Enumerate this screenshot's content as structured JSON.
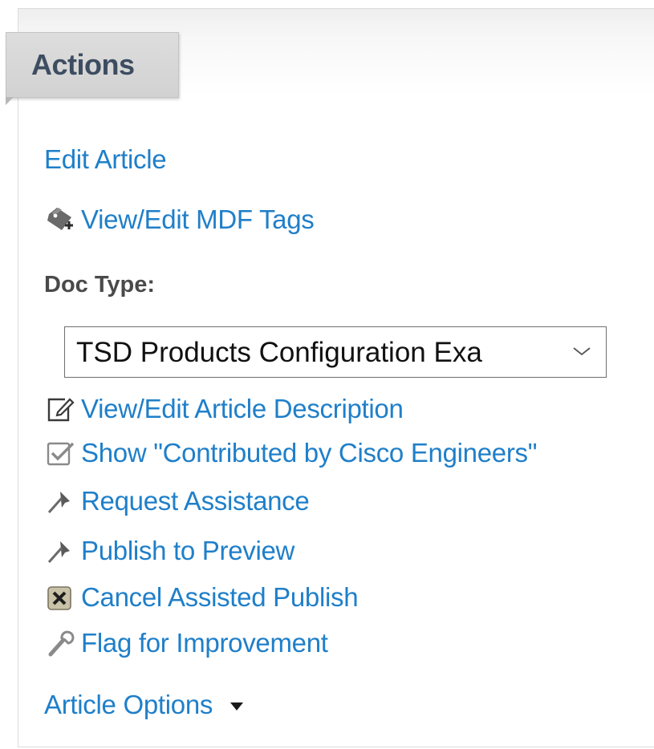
{
  "panel": {
    "title": "Actions"
  },
  "actions": {
    "edit_article": "Edit Article",
    "view_edit_mdf_tags": "View/Edit MDF Tags",
    "doc_type_label": "Doc Type:",
    "doc_type_value": "TSD Products Configuration Exa",
    "view_edit_description": "View/Edit Article Description",
    "show_contributed": "Show \"Contributed by Cisco Engineers\"",
    "request_assistance": "Request Assistance",
    "publish_preview": "Publish to Preview",
    "cancel_assisted": "Cancel Assisted Publish",
    "flag_improvement": "Flag for Improvement",
    "article_options": "Article Options"
  },
  "icons": {
    "tags": "tag-icon",
    "edit": "edit-icon",
    "checkbox": "checkbox-icon",
    "pin": "pin-icon",
    "cancel": "cancel-icon",
    "wrench": "wrench-icon",
    "dropdown": "chevron-down-icon",
    "caret": "caret-down-icon"
  },
  "colors": {
    "link": "#1f7fc9",
    "tab_bg": "#d2d2d2",
    "tab_text": "#3d4d61"
  }
}
